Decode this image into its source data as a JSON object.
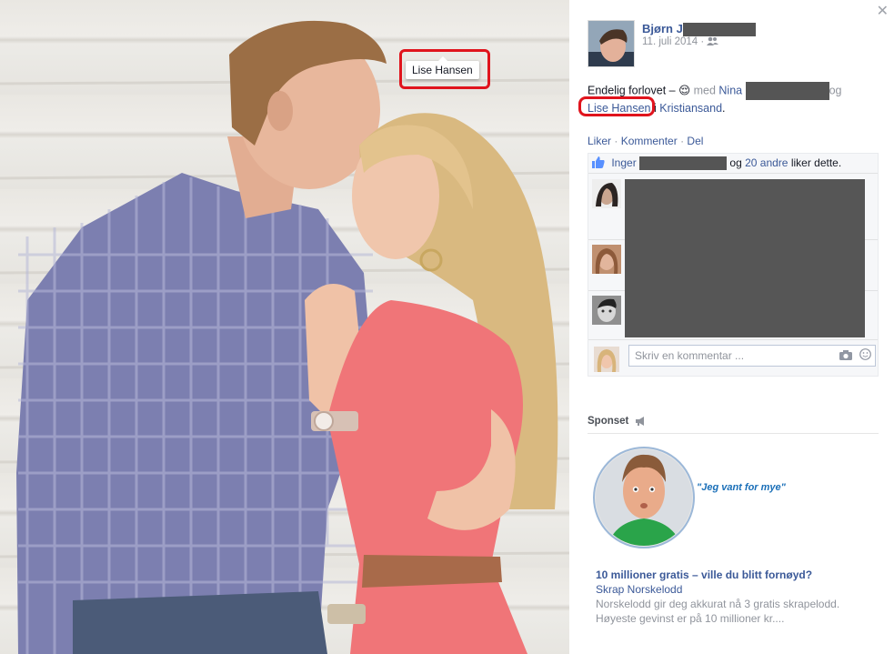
{
  "photo": {
    "tag_tooltip": "Lise Hansen"
  },
  "post": {
    "author_first": "Bjørn",
    "author_last_visible": "J",
    "date": "11. juli 2014",
    "date_sep": "·",
    "status_prefix": "Endelig forlovet –",
    "emoticon": "😌",
    "with_word": "med",
    "tag_1": "Nina",
    "and_word": "og",
    "tag_2": "Lise Hansen",
    "in_word": "i",
    "place": "Kristiansand",
    "period": ".",
    "actions": {
      "like": "Liker",
      "comment": "Kommenter",
      "share": "Del",
      "separator": "·"
    },
    "likes": {
      "first_liker": "Inger",
      "and_word": "og",
      "others": "20 andre",
      "suffix": "liker dette."
    },
    "comment_placeholder": "Skriv en kommentar ..."
  },
  "sponsored": {
    "label": "Sponset",
    "ad_quote": "\"Jeg vant for mye\"",
    "ad_title": "10 millioner gratis – ville du blitt fornøyd?",
    "ad_source": "Skrap Norskelodd",
    "ad_desc_1": "Norskelodd gir deg akkurat nå 3 gratis skrapelodd.",
    "ad_desc_2": "Høyeste gevinst er på 10 millioner kr...."
  },
  "colors": {
    "link": "#3b5998",
    "highlight": "#e0141d"
  }
}
